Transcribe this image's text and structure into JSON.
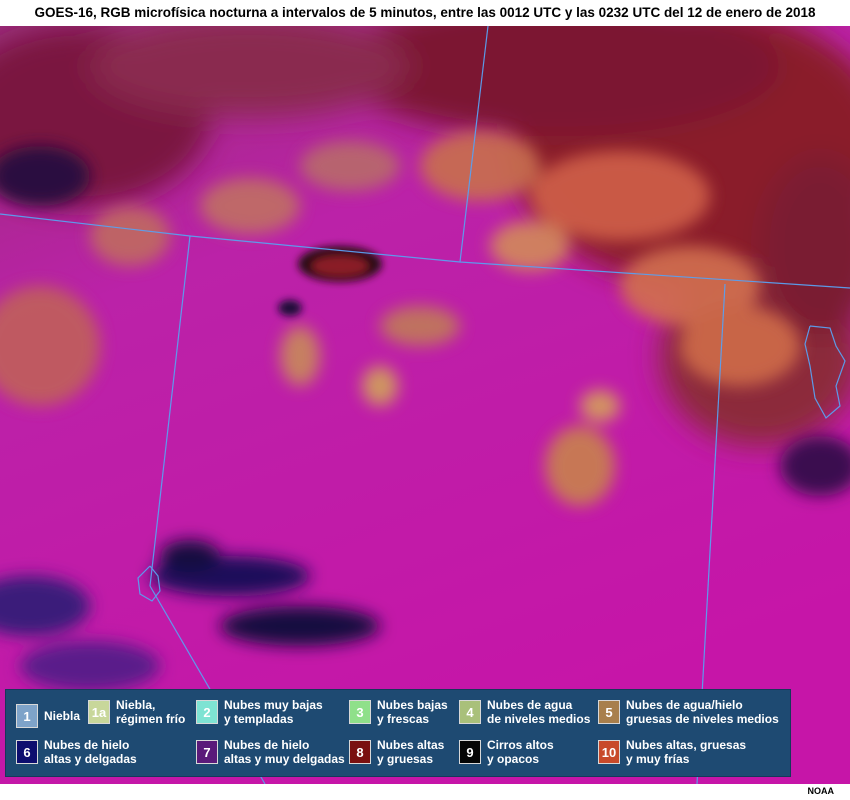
{
  "title": "GOES-16, RGB microfísica nocturna a intervalos de 5 minutos, entre las 0012 UTC y las 0232 UTC del 12 de enero de 2018",
  "credit": "NOAA",
  "legend": [
    {
      "key": "1",
      "label": "Niebla",
      "color": "#7ea3c9"
    },
    {
      "key": "1a",
      "label": "Niebla,\nrégimen frío",
      "color": "#c8d79a"
    },
    {
      "key": "2",
      "label": "Nubes muy bajas\ny templadas",
      "color": "#7ee3d3"
    },
    {
      "key": "3",
      "label": "Nubes bajas\ny frescas",
      "color": "#8fe08a"
    },
    {
      "key": "4",
      "label": "Nubes de agua\nde niveles medios",
      "color": "#a9c07a"
    },
    {
      "key": "5",
      "label": "Nubes de agua/hielo\ngruesas de niveles medios",
      "color": "#a87f4c"
    },
    {
      "key": "6",
      "label": "Nubes de hielo\naltas y delgadas",
      "color": "#0d0d6e"
    },
    {
      "key": "7",
      "label": "Nubes de hielo\naltas y muy delgadas",
      "color": "#5a1a7a"
    },
    {
      "key": "8",
      "label": "Nubes altas\ny gruesas",
      "color": "#7a1010"
    },
    {
      "key": "9",
      "label": "Cirros altos\ny opacos",
      "color": "#050505"
    },
    {
      "key": "10",
      "label": "Nubes altas, gruesas\ny muy frías",
      "color": "#c84a2a"
    }
  ]
}
